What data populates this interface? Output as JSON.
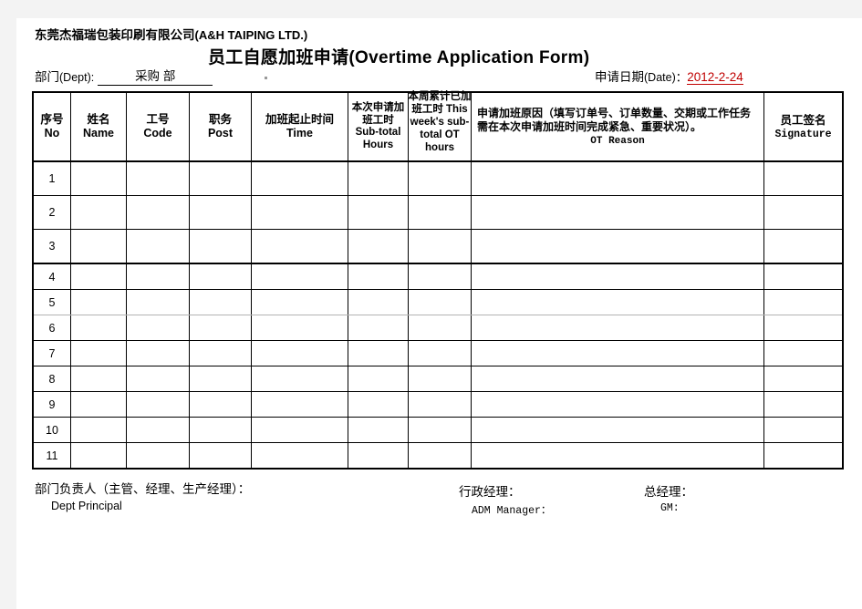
{
  "header": {
    "company_cn": "东莞杰福瑞包装印刷有限公司",
    "company_en": "(A&H TAIPING LTD.)",
    "form_title": "员工自愿加班申请(Overtime   Application   Form)",
    "dept_label_cn": "部门",
    "dept_label_en": "(Dept):",
    "dept_value": "采购 部",
    "date_label_cn": "申请日期",
    "date_label_en": "(Date)：",
    "date_value": "2012-2-24",
    "date_color": "#c00000"
  },
  "table": {
    "columns": [
      {
        "cn": "序号",
        "en": "No"
      },
      {
        "cn": "姓名",
        "en": "Name"
      },
      {
        "cn": "工号",
        "en": "Code"
      },
      {
        "cn": "职务",
        "en": "Post"
      },
      {
        "cn": "加班起止时间",
        "en": "Time"
      },
      {
        "cn": "本次申请加班工时",
        "en": "Sub-total Hours"
      },
      {
        "cn": "本周累计已加班工时",
        "en": "This week's sub-total OT  hours"
      },
      {
        "cn": "申请加班原因（填写订单号、订单数量、交期或工作任务需在本次申请加班时间完成紧急、重要状况）。",
        "en": "OT Reason"
      },
      {
        "cn": "员工签名",
        "en": "Signature"
      }
    ],
    "rows": [
      {
        "no": "1",
        "name": "",
        "code": "",
        "post": "",
        "time": "",
        "subtotal": "",
        "week": "",
        "reason": "",
        "signature": ""
      },
      {
        "no": "2",
        "name": "",
        "code": "",
        "post": "",
        "time": "",
        "subtotal": "",
        "week": "",
        "reason": "",
        "signature": ""
      },
      {
        "no": "3",
        "name": "",
        "code": "",
        "post": "",
        "time": "",
        "subtotal": "",
        "week": "",
        "reason": "",
        "signature": ""
      },
      {
        "no": "4",
        "name": "",
        "code": "",
        "post": "",
        "time": "",
        "subtotal": "",
        "week": "",
        "reason": "",
        "signature": ""
      },
      {
        "no": "5",
        "name": "",
        "code": "",
        "post": "",
        "time": "",
        "subtotal": "",
        "week": "",
        "reason": "",
        "signature": ""
      },
      {
        "no": "6",
        "name": "",
        "code": "",
        "post": "",
        "time": "",
        "subtotal": "",
        "week": "",
        "reason": "",
        "signature": ""
      },
      {
        "no": "7",
        "name": "",
        "code": "",
        "post": "",
        "time": "",
        "subtotal": "",
        "week": "",
        "reason": "",
        "signature": ""
      },
      {
        "no": "8",
        "name": "",
        "code": "",
        "post": "",
        "time": "",
        "subtotal": "",
        "week": "",
        "reason": "",
        "signature": ""
      },
      {
        "no": "9",
        "name": "",
        "code": "",
        "post": "",
        "time": "",
        "subtotal": "",
        "week": "",
        "reason": "",
        "signature": ""
      },
      {
        "no": "10",
        "name": "",
        "code": "",
        "post": "",
        "time": "",
        "subtotal": "",
        "week": "",
        "reason": "",
        "signature": ""
      },
      {
        "no": "11",
        "name": "",
        "code": "",
        "post": "",
        "time": "",
        "subtotal": "",
        "week": "",
        "reason": "",
        "signature": ""
      }
    ]
  },
  "footer": {
    "dept_principal_cn": "部门负责人（主管、经理、生产经理）：",
    "dept_principal_en": "Dept Principal",
    "adm_manager_cn": "行政经理：",
    "adm_manager_en": "ADM Manager：",
    "gm_cn": "总经理：",
    "gm_en": "GM:"
  }
}
